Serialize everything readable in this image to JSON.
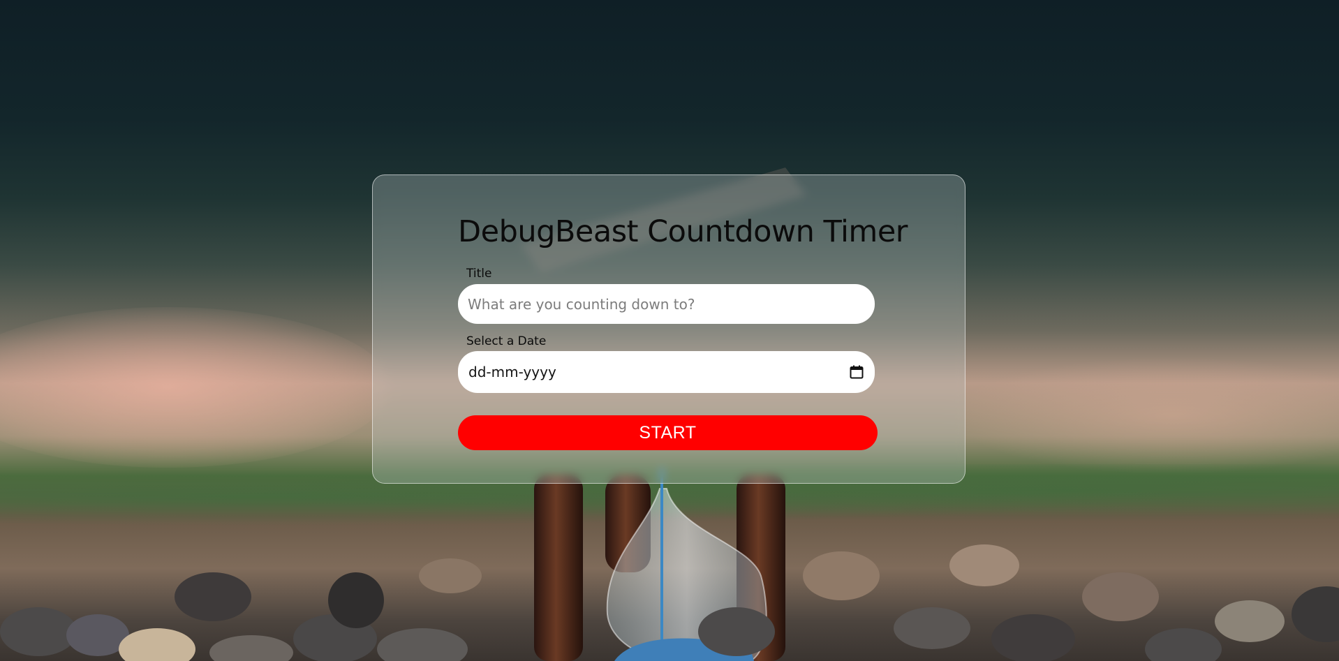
{
  "app": {
    "heading": "DebugBeast Countdown Timer"
  },
  "form": {
    "title_label": "Title",
    "title_placeholder": "What are you counting down to?",
    "title_value": "",
    "date_label": "Select a Date",
    "date_placeholder": "dd-mm-yyyy",
    "start_label": "START"
  },
  "icons": {
    "date_picker": "calendar-icon"
  },
  "colors": {
    "accent_button": "#ff0000",
    "button_text": "#ffffff",
    "heading_text": "#0b0b0b",
    "card_border": "#ffffff"
  }
}
